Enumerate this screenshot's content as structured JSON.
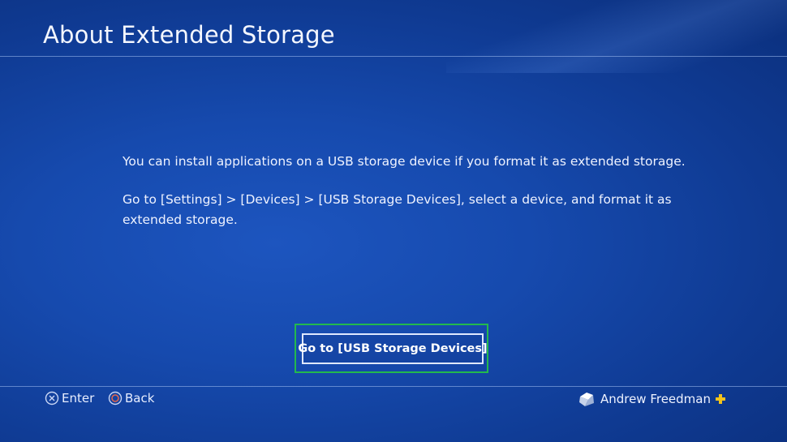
{
  "header": {
    "title": "About Extended Storage"
  },
  "content": {
    "paragraph1": "You can install applications on a USB storage device if you format it as extended storage.",
    "paragraph2": "Go to [Settings] > [Devices] > [USB Storage Devices], select a device, and format it as extended storage."
  },
  "action": {
    "button_label": "Go to [USB Storage Devices]"
  },
  "footer": {
    "hints": [
      {
        "icon": "cross-button-icon",
        "label": "Enter"
      },
      {
        "icon": "circle-button-icon",
        "label": "Back"
      }
    ],
    "user": {
      "name": "Andrew Freedman",
      "avatar_icon": "user-avatar-icon",
      "membership_icon": "playstation-plus-icon"
    }
  },
  "colors": {
    "background": "#164aae",
    "focus_ring": "#23b94d",
    "text": "#ffffff",
    "plus_gold": "#f2c21b"
  }
}
